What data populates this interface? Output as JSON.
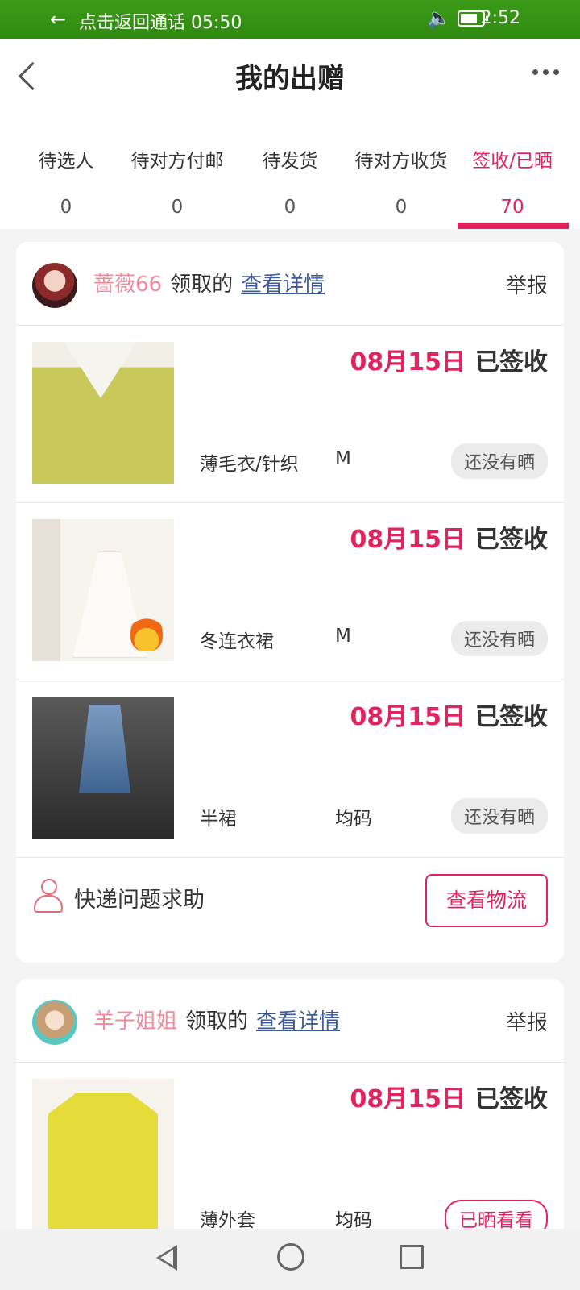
{
  "status_bar": {
    "back_arrow": "←",
    "call_return_text": "点击返回通话 05:50",
    "time": "2:52"
  },
  "header": {
    "title": "我的出赠"
  },
  "tabs": [
    {
      "label": "待选人",
      "count": "0"
    },
    {
      "label": "待对方付邮",
      "count": "0"
    },
    {
      "label": "待发货",
      "count": "0"
    },
    {
      "label": "待对方收货",
      "count": "0"
    },
    {
      "label": "签收/已晒",
      "count": "70"
    }
  ],
  "cards": [
    {
      "user": {
        "name": "蔷薇66",
        "label": "领取的",
        "detail_link": "查看详情"
      },
      "report": "举报",
      "items": [
        {
          "date": "08月15日",
          "status": "已签收",
          "category": "薄毛衣/针织",
          "size": "M",
          "badge": "还没有晒"
        },
        {
          "date": "08月15日",
          "status": "已签收",
          "category": "冬连衣裙",
          "size": "M",
          "badge": "还没有晒"
        },
        {
          "date": "08月15日",
          "status": "已签收",
          "category": "半裙",
          "size": "均码",
          "badge": "还没有晒"
        }
      ],
      "footer": {
        "help_text": "快递问题求助",
        "logistics_button": "查看物流"
      }
    },
    {
      "user": {
        "name": "羊子姐姐",
        "label": "领取的",
        "detail_link": "查看详情"
      },
      "report": "举报",
      "items": [
        {
          "date": "08月15日",
          "status": "已签收",
          "category": "薄外套",
          "size": "均码",
          "badge": "已晒看看"
        }
      ]
    }
  ],
  "colors": {
    "accent": "#e0245e",
    "username": "#f08a9c",
    "link": "#3d5b96",
    "status_bar": "#2f8a10"
  },
  "icons": [
    "back-chevron-icon",
    "more-icon",
    "volume-icon",
    "battery-icon",
    "user-icon",
    "nav-back-icon",
    "nav-home-icon",
    "nav-recent-icon"
  ]
}
